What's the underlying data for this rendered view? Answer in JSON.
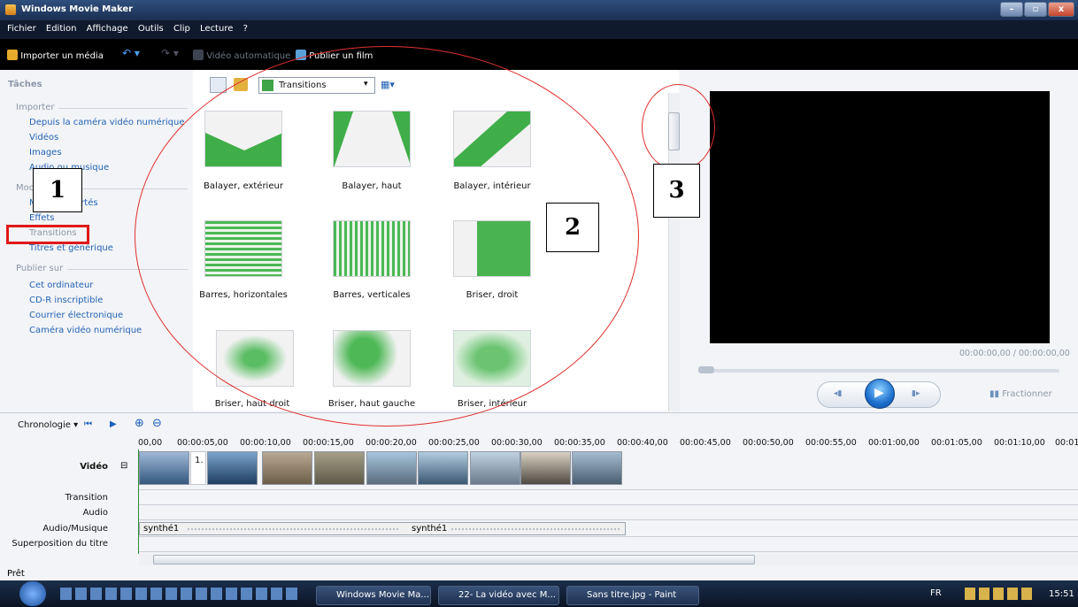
{
  "window": {
    "title": "Windows Movie Maker",
    "controls": [
      "–",
      "▫",
      "x"
    ]
  },
  "menu": [
    "Fichier",
    "Edition",
    "Affichage",
    "Outils",
    "Clip",
    "Lecture",
    "?"
  ],
  "toolbar": {
    "import": "Importer un média",
    "auto_movie": "Vidéo automatique",
    "publish": "Publier un film"
  },
  "tasks": {
    "header": "Tâches",
    "importer": {
      "title": "Importer",
      "items": [
        "Depuis la caméra vidéo numérique",
        "Vidéos",
        "Images",
        "Audio ou musique"
      ]
    },
    "modifier": {
      "title": "Modifier",
      "items": [
        "Média importés",
        "Effets",
        "Transitions",
        "Titres et générique"
      ]
    },
    "publier": {
      "title": "Publier sur",
      "items": [
        "Cet ordinateur",
        "CD-R inscriptible",
        "Courrier électronique",
        "Caméra vidéo numérique"
      ]
    }
  },
  "content": {
    "dropdown": "Transitions",
    "transitions": [
      "Balayer, extérieur",
      "Balayer, haut",
      "Balayer, intérieur",
      "Barres, horizontales",
      "Barres, verticales",
      "Briser, droit",
      "Briser, haut droit",
      "Briser, haut gauche",
      "Briser, intérieur"
    ]
  },
  "preview": {
    "time": "00:00:00,00 / 00:00:00,00",
    "split": "Fractionner"
  },
  "timeline": {
    "mode": "Chronologie",
    "ticks": [
      "00,00",
      "00:00:05,00",
      "00:00:10,00",
      "00:00:15,00",
      "00:00:20,00",
      "00:00:25,00",
      "00:00:30,00",
      "00:00:35,00",
      "00:00:40,00",
      "00:00:45,00",
      "00:00:50,00",
      "00:00:55,00",
      "00:01:00,00",
      "00:01:05,00",
      "00:01:10,00",
      "00:01"
    ],
    "tracks": [
      "Vidéo",
      "Transition",
      "Audio",
      "Audio/Musique",
      "Superposition du titre"
    ],
    "first_clip_label": "1.",
    "audio_clips": [
      "synthé1",
      "synthé1"
    ]
  },
  "status": "Prêt",
  "taskbar": {
    "tasks": [
      "Windows Movie Ma...",
      "22- La vidéo avec M...",
      "Sans titre.jpg - Paint"
    ],
    "lang": "FR",
    "clock": "15:51"
  },
  "annotations": [
    "1",
    "2",
    "3"
  ]
}
